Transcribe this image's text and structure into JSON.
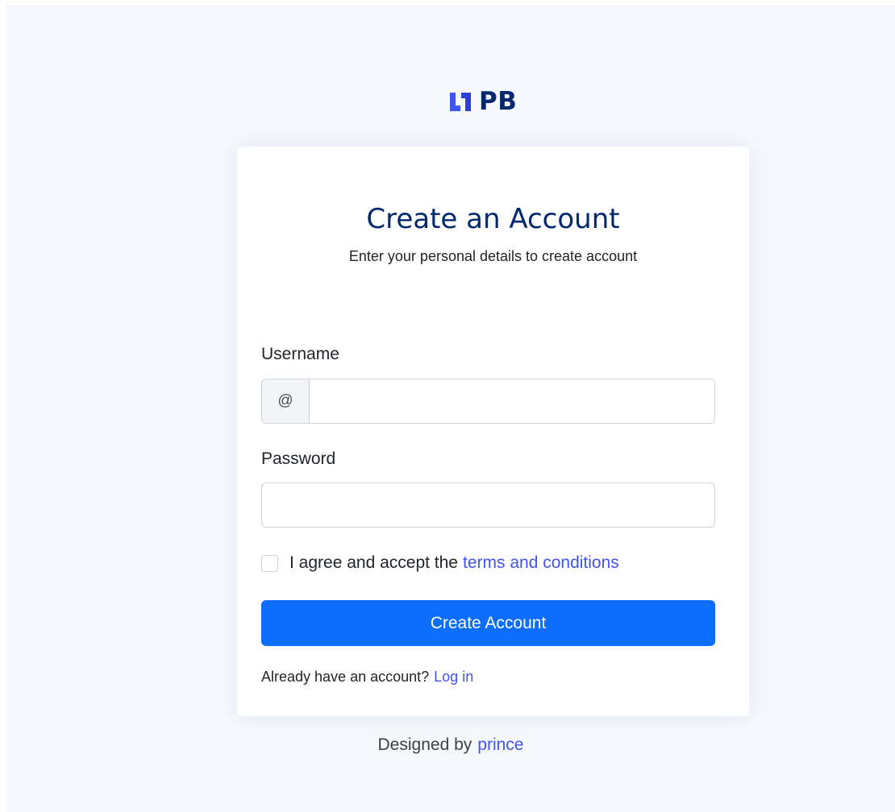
{
  "brand": {
    "name": "PB",
    "logo_icon": "brand-logo-icon",
    "color": "#012970",
    "logo_color": "#4154f1"
  },
  "card": {
    "title": "Create an Account",
    "subtitle": "Enter your personal details to create account"
  },
  "form": {
    "username_label": "Username",
    "username_prefix": "@",
    "username_value": "",
    "password_label": "Password",
    "password_value": "",
    "terms_checked": false,
    "terms_text": "I agree and accept the",
    "terms_link": "terms and conditions",
    "submit_label": "Create Account",
    "login_prompt": "Already have an account?",
    "login_link": "Log in"
  },
  "footer": {
    "designed_by": "Designed by",
    "designer": "prince"
  },
  "colors": {
    "background": "#f5f8fd",
    "primary_button": "#0d6efd",
    "link": "#4154f1",
    "title": "#012970"
  }
}
